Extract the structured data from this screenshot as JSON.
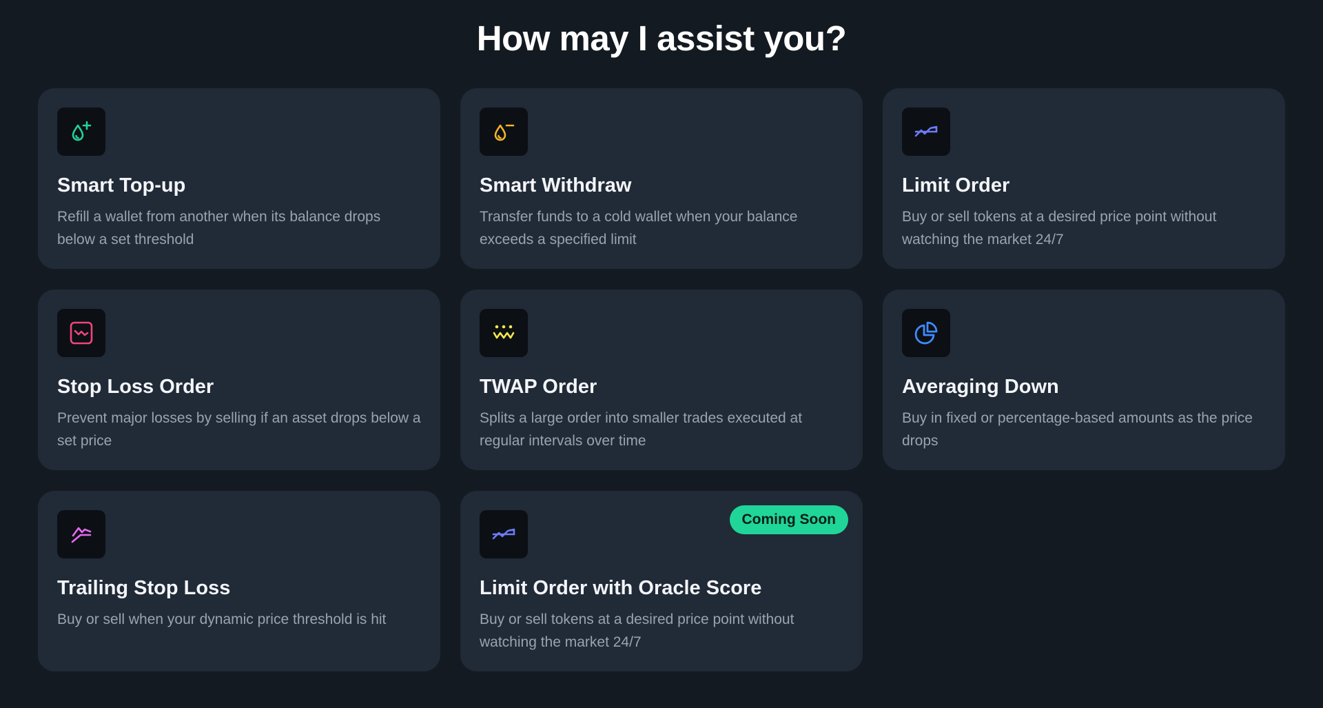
{
  "heading": "How may I assist you?",
  "cards": [
    {
      "title": "Smart Top-up",
      "description": "Refill a wallet from another when its balance drops below a set threshold",
      "icon": "drop-plus-icon",
      "color": "#22d497"
    },
    {
      "title": "Smart Withdraw",
      "description": "Transfer funds to a cold wallet when your balance exceeds a specified limit",
      "icon": "drop-minus-icon",
      "color": "#f3b42a"
    },
    {
      "title": "Limit Order",
      "description": "Buy or sell tokens at a desired price point without watching the market 24/7",
      "icon": "trend-cross-icon",
      "color": "#6b7cf5"
    },
    {
      "title": "Stop Loss Order",
      "description": "Prevent major losses by selling if an asset drops below a set price",
      "icon": "chart-down-icon",
      "color": "#f0467a"
    },
    {
      "title": "TWAP Order",
      "description": "Splits a large order into smaller trades executed at regular intervals over time",
      "icon": "dots-zigzag-icon",
      "color": "#f5e84a"
    },
    {
      "title": "Averaging Down",
      "description": "Buy in fixed or percentage-based amounts as the price drops",
      "icon": "pie-chart-icon",
      "color": "#3f8bff"
    },
    {
      "title": "Trailing Stop Loss",
      "description": "Buy or sell when your dynamic price threshold is hit",
      "icon": "trail-line-icon",
      "color": "#e56bf2"
    },
    {
      "title": "Limit Order with Oracle Score",
      "description": "Buy or sell tokens at a desired price point without watching the market 24/7",
      "icon": "trend-cross-icon",
      "color": "#6b7cf5",
      "badge": "Coming Soon"
    }
  ]
}
